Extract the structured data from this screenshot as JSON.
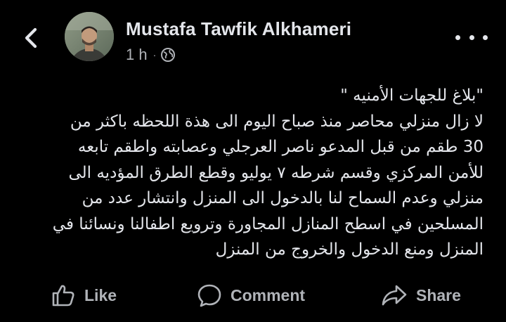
{
  "header": {
    "back_icon": "chevron-left-icon",
    "author_name": "Mustafa Tawfik Alkhameri",
    "time_ago": "1 h",
    "separator": "·",
    "audience_icon": "globe-icon",
    "more_icon": "more-horizontal-icon"
  },
  "post": {
    "lines": [
      "\"بلاغ للجهات الأمنيه \"",
      "لا زال منزلي محاصر منذ صباح اليوم الى هذة اللحظه باكثر من",
      "30 طقم من قبل المدعو ناصر العرجلي وعصابته واطقم تابعه",
      "للأمن المركزي وقسم شرطه ٧ يوليو وقطع الطرق المؤديه الى",
      "منزلي وعدم السماح لنا بالدخول الى المنزل وانتشار عدد من",
      "المسلحين في اسطح المنازل المجاورة وترويع اطفالنا ونسائنا في",
      "المنزل ومنع الدخول والخروج من المنزل"
    ]
  },
  "actions": {
    "like_label": "Like",
    "comment_label": "Comment",
    "share_label": "Share",
    "like_icon": "thumbs-up-icon",
    "comment_icon": "comment-bubble-icon",
    "share_icon": "share-arrow-icon"
  },
  "colors": {
    "background": "#000000",
    "primary_text": "#e4e6eb",
    "secondary_text": "#b0b3b8"
  }
}
